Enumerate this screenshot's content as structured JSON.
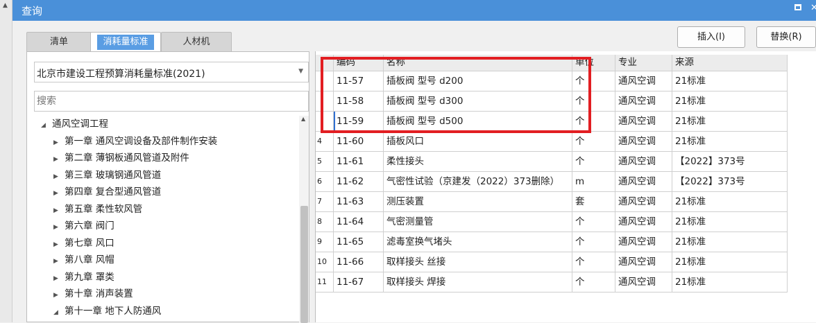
{
  "window": {
    "title": "查询"
  },
  "tabs": [
    {
      "label": "清单",
      "active": false
    },
    {
      "label": "消耗量标准",
      "active": true
    },
    {
      "label": "人材机",
      "active": false
    }
  ],
  "toolbar": {
    "insert_label": "插入(I)",
    "replace_label": "替换(R)"
  },
  "left": {
    "standard_selected": "北京市建设工程预算消耗量标准(2021)",
    "search_placeholder": "搜索",
    "tree": [
      {
        "label": "通风空调工程",
        "level": 0,
        "expanded": true
      },
      {
        "label": "第一章 通风空调设备及部件制作安装",
        "level": 1,
        "expanded": false
      },
      {
        "label": "第二章 薄钢板通风管道及附件",
        "level": 1,
        "expanded": false
      },
      {
        "label": "第三章 玻璃钢通风管道",
        "level": 1,
        "expanded": false
      },
      {
        "label": "第四章 复合型通风管道",
        "level": 1,
        "expanded": false
      },
      {
        "label": "第五章 柔性软风管",
        "level": 1,
        "expanded": false
      },
      {
        "label": "第六章 阀门",
        "level": 1,
        "expanded": false
      },
      {
        "label": "第七章 风口",
        "level": 1,
        "expanded": false
      },
      {
        "label": "第八章 风帽",
        "level": 1,
        "expanded": false
      },
      {
        "label": "第九章 罩类",
        "level": 1,
        "expanded": false
      },
      {
        "label": "第十章 消声装置",
        "level": 1,
        "expanded": false
      },
      {
        "label": "第十一章 地下人防通风",
        "level": 1,
        "expanded": true
      }
    ]
  },
  "table": {
    "columns": [
      "编码",
      "名称",
      "单位",
      "专业",
      "来源"
    ],
    "rows": [
      {
        "num": "",
        "code": "11-57",
        "name": "插板阀 型号 d200",
        "unit": "个",
        "major": "通风空调",
        "source": "21标准"
      },
      {
        "num": "",
        "code": "11-58",
        "name": "插板阀 型号 d300",
        "unit": "个",
        "major": "通风空调",
        "source": "21标准"
      },
      {
        "num": "",
        "code": "11-59",
        "name": "插板阀 型号 d500",
        "unit": "个",
        "major": "通风空调",
        "source": "21标准"
      },
      {
        "num": "4",
        "code": "11-60",
        "name": "插板风口",
        "unit": "个",
        "major": "通风空调",
        "source": "21标准"
      },
      {
        "num": "5",
        "code": "11-61",
        "name": "柔性接头",
        "unit": "个",
        "major": "通风空调",
        "source": "【2022】373号"
      },
      {
        "num": "6",
        "code": "11-62",
        "name": "气密性试验（京建发（2022）373删除）",
        "unit": "m",
        "major": "通风空调",
        "source": "【2022】373号"
      },
      {
        "num": "7",
        "code": "11-63",
        "name": "测压装置",
        "unit": "套",
        "major": "通风空调",
        "source": "21标准"
      },
      {
        "num": "8",
        "code": "11-64",
        "name": "气密测量管",
        "unit": "个",
        "major": "通风空调",
        "source": "21标准"
      },
      {
        "num": "9",
        "code": "11-65",
        "name": "滤毒室换气堵头",
        "unit": "个",
        "major": "通风空调",
        "source": "21标准"
      },
      {
        "num": "10",
        "code": "11-66",
        "name": "取样接头 丝接",
        "unit": "个",
        "major": "通风空调",
        "source": "21标准"
      },
      {
        "num": "11",
        "code": "11-67",
        "name": "取样接头 焊接",
        "unit": "个",
        "major": "通风空调",
        "source": "21标准"
      }
    ]
  },
  "colors": {
    "titlebar": "#4a90d9",
    "active_tab": "#5a9de3",
    "highlight": "#e21e22"
  }
}
